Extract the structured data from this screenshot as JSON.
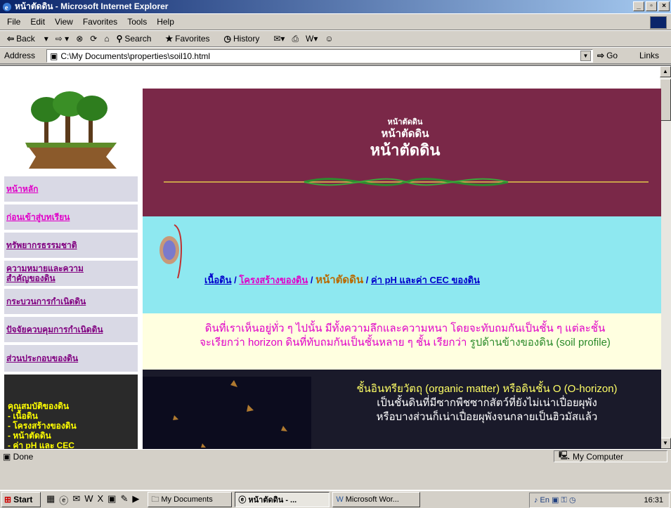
{
  "window": {
    "title": "หน้าตัดดิน - Microsoft Internet Explorer"
  },
  "menu": [
    "File",
    "Edit",
    "View",
    "Favorites",
    "Tools",
    "Help"
  ],
  "toolbar": {
    "back": "Back",
    "search": "Search",
    "favorites": "Favorites",
    "history": "History"
  },
  "address": {
    "label": "Address",
    "value": "C:\\My Documents\\properties\\soil10.html",
    "go": "Go",
    "links": "Links"
  },
  "nav": {
    "items": [
      "หน้าหลัก",
      "ก่อนเข้าสู่บทเรียน",
      "ทรัพยากรธรรมชาติ",
      "ความหมายและความสำคัญของดิน",
      "กระบวนการกำเนิดดิน",
      "ปัจจัยควบคุมการกำเนิดดิน",
      "ส่วนประกอบของดิน"
    ],
    "dark_title": "คุณสมบัติของดิน",
    "dark_items": [
      "- เนื้อดิน",
      "- โครงสร้างของดิน",
      "- หน้าตัดดิน",
      "- ค่า pH และ CEC"
    ]
  },
  "banner": {
    "t1": "หน้าตัดดิน",
    "t2": "หน้าตัดดิน",
    "t3": "หน้าตัดดิน"
  },
  "links": {
    "a": "เนื้อดิน",
    "b": "โครงสร้างของดิน",
    "current": "หน้าตัดดิน",
    "d": "ค่า pH และค่า CEC ของดิน",
    "sep": " / "
  },
  "intro": {
    "line1": "ดินที่เราเห็นอยู่ทั่ว ๆ ไปนั้น มีทั้งความลึกและความหนา โดยจะทับถมกันเป็นชั้น ๆ แต่ละชั้น",
    "line2a": "จะเรียกว่า horizon ดินที่ทับถมกันเป็นชั้นหลาย ๆ ชั้น เรียกว่า ",
    "line2b": "รูปด้านข้างของดิน (soil profile)"
  },
  "section": {
    "title": "ชั้นอินทรียวัตถุ (organic matter) หรือดินชั้น O (O-horizon)",
    "line1": "เป็นชั้นดินที่มีซากพืชซากสัตว์ที่ยังไม่เน่าเปื่อยผุพัง",
    "line2": "หรือบางส่วนก็เน่าเปื่อยผุพังจนกลายเป็นฮิวมัสแล้ว"
  },
  "status": {
    "done": "Done",
    "zone": "My Computer"
  },
  "taskbar": {
    "start": "Start",
    "tasks": [
      "My Documents",
      "หน้าตัดดิน - ...",
      "Microsoft Wor..."
    ],
    "clock": "16:31"
  }
}
